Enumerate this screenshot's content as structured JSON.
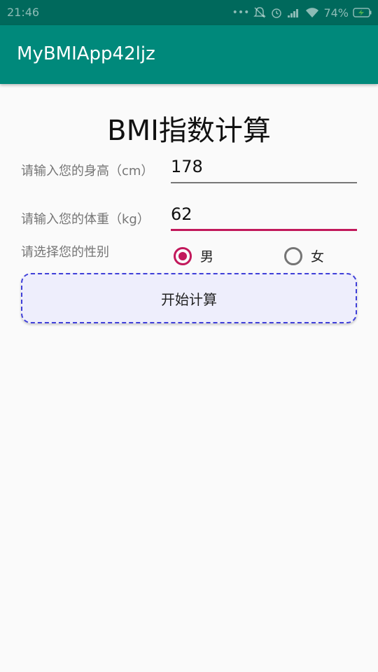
{
  "status_bar": {
    "time": "21:46",
    "battery": "74%",
    "icons": [
      "more-dots-icon",
      "mute-icon",
      "alarm-icon",
      "signal-icon",
      "wifi-icon",
      "battery-charging-icon"
    ]
  },
  "app_bar": {
    "title": "MyBMIApp42ljz"
  },
  "form": {
    "title": "BMI指数计算",
    "height_label": "请输入您的身高（cm）",
    "height_value": "178",
    "weight_label": "请输入您的体重（kg）",
    "weight_value": "62",
    "gender_label": "请选择您的性别",
    "gender_options": [
      {
        "label": "男",
        "selected": true
      },
      {
        "label": "女",
        "selected": false
      }
    ],
    "calculate_label": "开始计算"
  },
  "colors": {
    "status_bar": "#00695c",
    "app_bar": "#00897b",
    "accent": "#c2185b",
    "button_border": "#3f3fd9",
    "button_fill": "#eeeefc"
  }
}
